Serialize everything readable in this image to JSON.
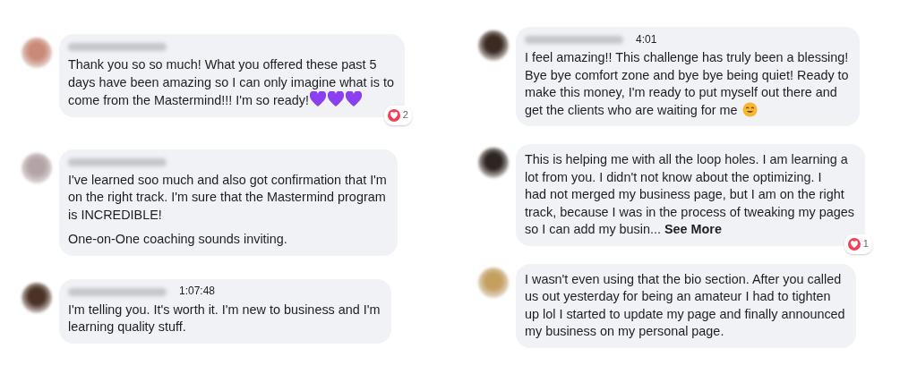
{
  "columns": [
    {
      "comments": [
        {
          "kind": "hearts",
          "name_blurred": true,
          "paragraphs": [
            "Thank you so so much! What you offered these past 5\ndays have been amazing so I can only imagine what is to\ncome from the Mastermind!!! I'm so ready!"
          ],
          "reaction_count": "2"
        },
        {
          "kind": "plain",
          "name_blurred": true,
          "paragraphs": [
            "I've learned soo much and also got confirmation that I'm\non the right track. I'm sure that the Mastermind program\nis INCREDIBLE!",
            "One-on-One coaching sounds inviting."
          ]
        },
        {
          "kind": "plain",
          "name_blurred": true,
          "time": "1:07:48",
          "paragraphs": [
            "I'm telling you. It's worth it. I'm new to business and I'm\nlearning quality stuff."
          ]
        }
      ]
    },
    {
      "comments": [
        {
          "kind": "smile",
          "name_blurred": true,
          "time": "4:01",
          "paragraphs": [
            "I feel amazing!! This challenge has truly been a blessing!\nBye bye comfort zone and bye bye being quiet! Ready to\nmake this money, I'm ready to put myself out there and\nget the clients who are waiting for me"
          ]
        },
        {
          "kind": "plain",
          "name_blurred": false,
          "paragraphs": [
            "This is helping me with all the loop holes. I am learning a\nlot from you. I didn't not know about the optimizing. I\nhad not merged my business page, but I am on the right\ntrack, because I was in the process of tweaking my pages\nso I can add my busin..."
          ],
          "see_more": "See More",
          "reaction_count": "1"
        },
        {
          "kind": "plain",
          "name_blurred": false,
          "paragraphs": [
            "I wasn't even using that the bio section. After you called\nus out yesterday for being an amateur I had to tighten\nup lol I started to update my page and finally announced\nmy business on my personal page."
          ]
        }
      ]
    }
  ]
}
